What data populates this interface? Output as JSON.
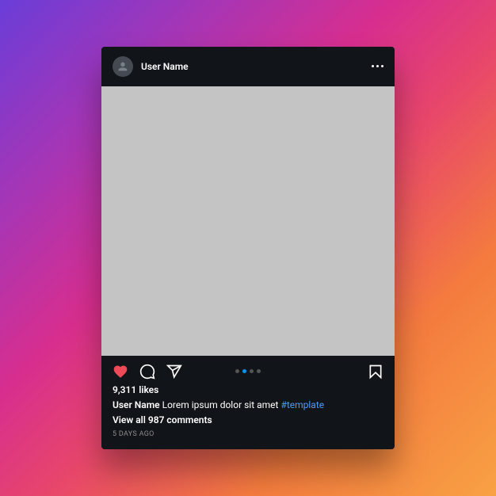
{
  "header": {
    "username": "User Name"
  },
  "actions": {
    "liked": true,
    "carousel_dots": 4,
    "active_dot": 2
  },
  "meta": {
    "likes_text": "9,311 likes",
    "caption_user": "User Name",
    "caption_text": "Lorem ipsum dolor sit amet",
    "caption_hashtag": "#template",
    "view_comments_text": "View all 987 comments",
    "timestamp": "5 DAYS AGO"
  },
  "colors": {
    "like_active": "#ed4956",
    "link": "#4a9eff",
    "card_bg": "#111419"
  }
}
